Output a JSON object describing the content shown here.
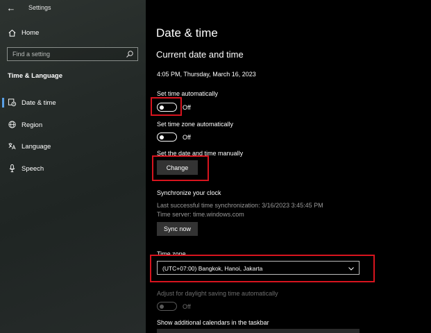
{
  "window": {
    "title": "Settings",
    "back_glyph": "←"
  },
  "sidebar": {
    "home_label": "Home",
    "search_placeholder": "Find a setting",
    "section_title": "Time & Language",
    "items": [
      {
        "label": "Date & time",
        "icon": "calendar-clock-icon",
        "selected": true
      },
      {
        "label": "Region",
        "icon": "globe-icon",
        "selected": false
      },
      {
        "label": "Language",
        "icon": "language-icon",
        "selected": false
      },
      {
        "label": "Speech",
        "icon": "microphone-icon",
        "selected": false
      }
    ]
  },
  "main": {
    "title": "Date & time",
    "subtitle": "Current date and time",
    "current_datetime": "4:05 PM, Thursday, March 16, 2023",
    "set_time_auto": {
      "label": "Set time automatically",
      "state": "Off"
    },
    "set_tz_auto": {
      "label": "Set time zone automatically",
      "state": "Off"
    },
    "manual": {
      "label": "Set the date and time manually",
      "button": "Change"
    },
    "sync": {
      "heading": "Synchronize your clock",
      "last_sync": "Last successful time synchronization: 3/16/2023 3:45:45 PM",
      "server": "Time server: time.windows.com",
      "button": "Sync now"
    },
    "timezone": {
      "label": "Time zone",
      "value": "(UTC+07:00) Bangkok, Hanoi, Jakarta"
    },
    "dst": {
      "label": "Adjust for daylight saving time automatically",
      "state": "Off"
    },
    "additional_calendars": {
      "label": "Show additional calendars in the taskbar"
    }
  },
  "colors": {
    "accent": "#5aa0e6",
    "highlight": "#d8141e",
    "button_bg": "#333333"
  }
}
